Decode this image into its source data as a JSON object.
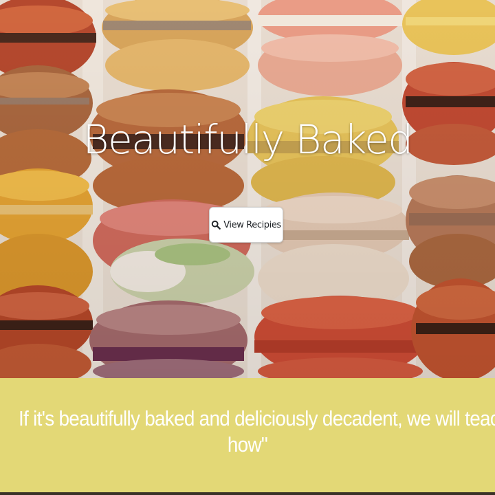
{
  "hero": {
    "title": "Beautifully Baked",
    "button_label": "View Recipies",
    "button_icon": "search-icon",
    "image_subject": "macarons"
  },
  "tagline": {
    "line1": "If it's beautifully baked and deliciously decadent, we will teach you",
    "line2": "how\""
  },
  "colors": {
    "tagline_band": "#e3d876",
    "hero_title": "#ffffff",
    "tagline_text": "#ffffff",
    "button_background": "#ffffff"
  }
}
